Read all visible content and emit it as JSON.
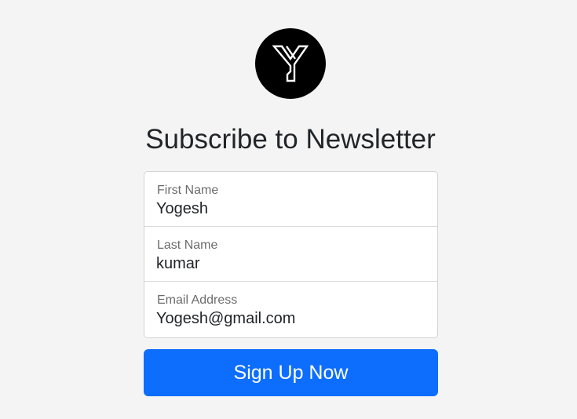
{
  "logo": {
    "icon": "y-monogram-icon",
    "background": "#000000"
  },
  "heading": "Subscribe to Newsletter",
  "form": {
    "fields": [
      {
        "label": "First Name",
        "value": "Yogesh"
      },
      {
        "label": "Last Name",
        "value": "kumar"
      },
      {
        "label": "Email Address",
        "value": "Yogesh@gmail.com"
      }
    ],
    "submit_label": "Sign Up Now",
    "accent": "#0d6efd"
  }
}
